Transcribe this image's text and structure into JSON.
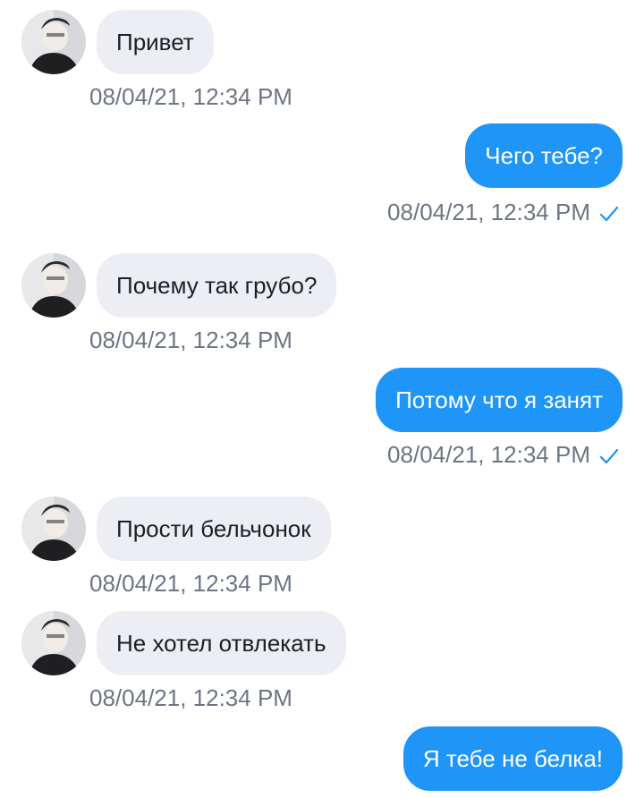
{
  "colors": {
    "incoming_bubble": "#eceef4",
    "outgoing_bubble": "#1e95f7",
    "timestamp": "#6d7584",
    "read_check": "#1e95f7"
  },
  "messages": [
    {
      "direction": "incoming",
      "text": "Привет",
      "time": "08/04/21, 12:34 PM",
      "avatar_icon": "user-avatar"
    },
    {
      "direction": "outgoing",
      "text": "Чего тебе?",
      "time": "08/04/21, 12:34 PM",
      "status_icon": "read-check-icon"
    },
    {
      "direction": "incoming",
      "text": "Почему так грубо?",
      "time": "08/04/21, 12:34 PM",
      "avatar_icon": "user-avatar"
    },
    {
      "direction": "outgoing",
      "text": "Потому что я занят",
      "time": "08/04/21, 12:34 PM",
      "status_icon": "read-check-icon"
    },
    {
      "direction": "incoming",
      "text": "Прости бельчонок",
      "time": "08/04/21, 12:34 PM",
      "avatar_icon": "user-avatar"
    },
    {
      "direction": "incoming",
      "text": "Не хотел отвлекать",
      "time": "08/04/21, 12:34 PM",
      "avatar_icon": "user-avatar"
    },
    {
      "direction": "outgoing",
      "text": "Я тебе не белка!",
      "avatar_icon": null
    }
  ]
}
